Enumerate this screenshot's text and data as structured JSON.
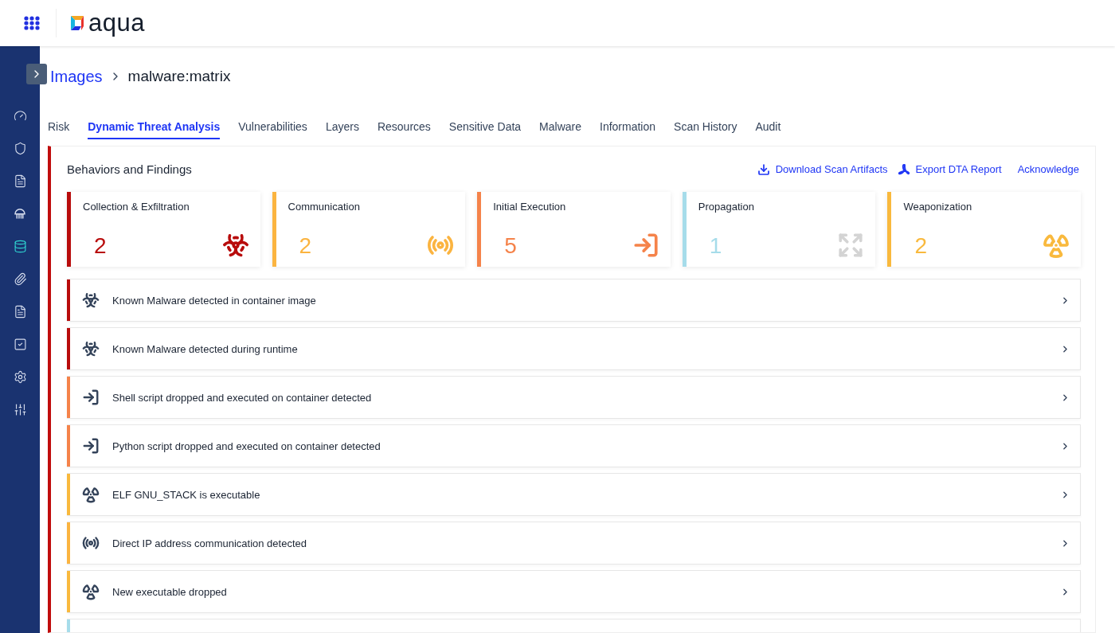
{
  "header": {
    "logo": "aqua"
  },
  "sidebar": {
    "items": [
      {
        "selected": false
      },
      {
        "selected": false
      },
      {
        "selected": false
      },
      {
        "selected": false
      },
      {
        "selected": true
      },
      {
        "selected": false
      },
      {
        "selected": false
      },
      {
        "selected": false
      },
      {
        "selected": false
      },
      {
        "selected": false
      }
    ]
  },
  "breadcrumb": {
    "parent": "Images",
    "current": "malware:matrix"
  },
  "tabs": [
    {
      "label": "Risk",
      "selected": false
    },
    {
      "label": "Dynamic Threat Analysis",
      "selected": true
    },
    {
      "label": "Vulnerabilities",
      "selected": false
    },
    {
      "label": "Layers",
      "selected": false
    },
    {
      "label": "Resources",
      "selected": false
    },
    {
      "label": "Sensitive Data",
      "selected": false
    },
    {
      "label": "Malware",
      "selected": false
    },
    {
      "label": "Information",
      "selected": false
    },
    {
      "label": "Scan History",
      "selected": false
    },
    {
      "label": "Audit",
      "selected": false
    }
  ],
  "panel": {
    "title": "Behaviors and Findings",
    "color": "#c00c0c",
    "actions": [
      {
        "kind": "download",
        "label": "Download Scan Artifacts"
      },
      {
        "kind": "export",
        "label": "Export DTA Report"
      },
      {
        "kind": "plain",
        "label": "Acknowledge"
      }
    ]
  },
  "categories": [
    {
      "label": "Collection & Exfiltration",
      "count": "2",
      "color": "#b80c0c",
      "kind": "biohazard"
    },
    {
      "label": "Communication",
      "count": "2",
      "color": "#fbb440",
      "kind": "signal"
    },
    {
      "label": "Initial Execution",
      "count": "5",
      "color": "#f5834a",
      "kind": "entry"
    },
    {
      "label": "Propagation",
      "count": "1",
      "color": "#a6dcea",
      "kind": "spread"
    },
    {
      "label": "Weaponization",
      "count": "2",
      "color": "#f9b93d",
      "kind": "radiation"
    }
  ],
  "findings": [
    {
      "text": "Known Malware detected in container image",
      "color": "#b80c0c",
      "kind": "biohazard"
    },
    {
      "text": "Known Malware detected during runtime",
      "color": "#b80c0c",
      "kind": "biohazard"
    },
    {
      "text": "Shell script dropped and executed on container detected",
      "color": "#f5834a",
      "kind": "entry"
    },
    {
      "text": "Python script dropped and executed on container detected",
      "color": "#f5834a",
      "kind": "entry"
    },
    {
      "text": "ELF GNU_STACK is executable",
      "color": "#f9b93d",
      "kind": "radiation"
    },
    {
      "text": "Direct IP address communication detected",
      "color": "#fbb440",
      "kind": "signal"
    },
    {
      "text": "New executable dropped",
      "color": "#f9b93d",
      "kind": "radiation"
    },
    {
      "color": "#a6dcea"
    }
  ]
}
